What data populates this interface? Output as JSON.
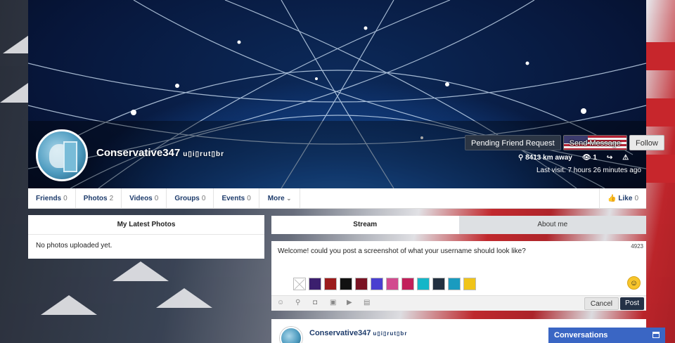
{
  "profile": {
    "username": "Conservative347",
    "user_tag": "u▯i▯rut▯br",
    "buttons": {
      "pending": "Pending Friend Request",
      "message": "Send Message",
      "follow": "Follow"
    },
    "distance": "8413 km away",
    "views": "1",
    "last_visit": "Last visit: 7 hours 26 minutes ago",
    "icons": {
      "location": "map-pin-icon",
      "views": "eye-icon",
      "share": "share-icon",
      "report": "warning-icon"
    }
  },
  "tabs": [
    {
      "label": "Friends",
      "count": "0"
    },
    {
      "label": "Photos",
      "count": "2"
    },
    {
      "label": "Videos",
      "count": "0"
    },
    {
      "label": "Groups",
      "count": "0"
    },
    {
      "label": "Events",
      "count": "0"
    }
  ],
  "more_tab": "More",
  "like": {
    "label": "Like",
    "count": "0"
  },
  "photos_panel": {
    "title": "My Latest Photos",
    "empty_text": "No photos uploaded yet."
  },
  "stream_tabs": {
    "stream": "Stream",
    "about": "About me"
  },
  "composer": {
    "text": "Welcome! could you post a screenshot of what your username should look like?",
    "char_count": "4923",
    "swatch_colors": [
      "#ffffff",
      "#3b1f6e",
      "#9b1b1b",
      "#111111",
      "#7a1424",
      "#4a3fd0",
      "#d24b8f",
      "#c2205a",
      "#15b6c8",
      "#223040",
      "#1a9bbf",
      "#f0c419"
    ],
    "cancel": "Cancel",
    "post": "Post"
  },
  "stream_item": {
    "username": "Conservative347",
    "user_tag": "u▯i▯rut▯br"
  },
  "conversations": {
    "label": "Conversations"
  }
}
